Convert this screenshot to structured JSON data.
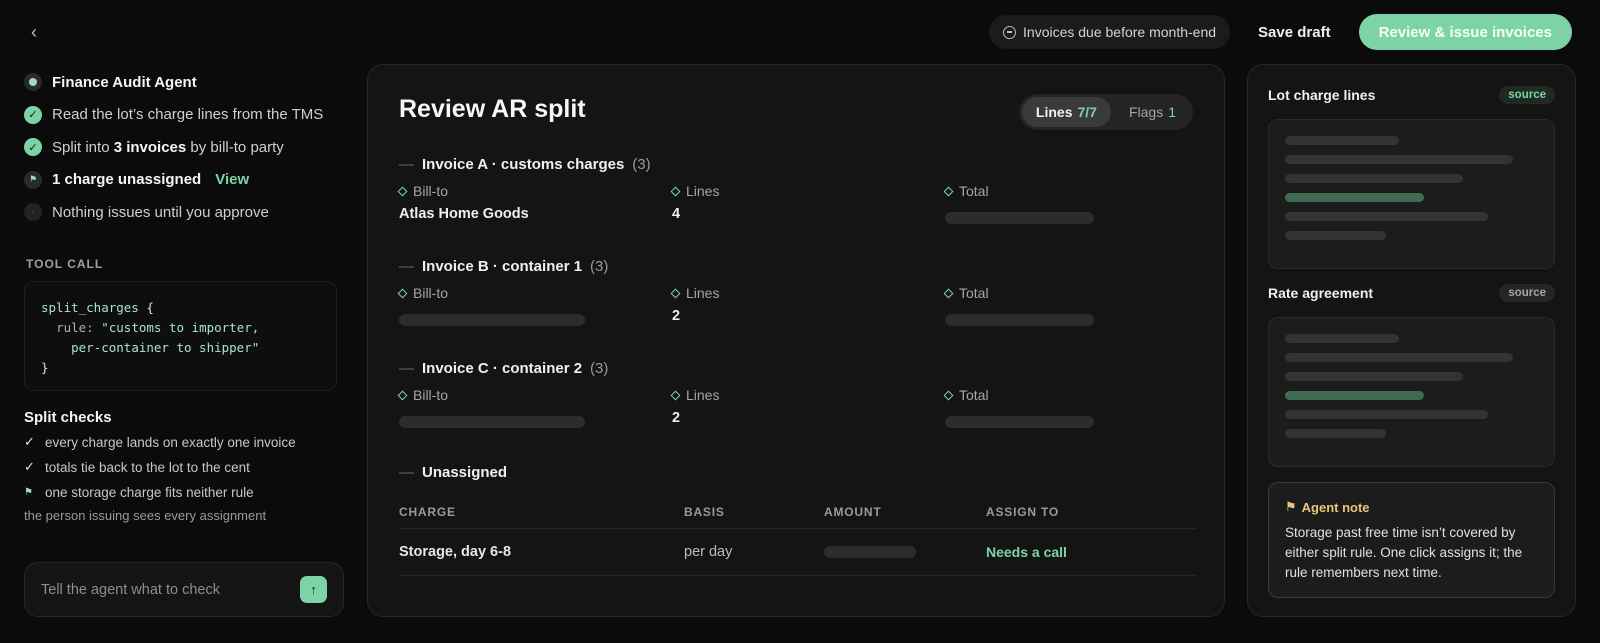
{
  "header": {
    "back_icon": "chevron-left-icon",
    "due_pill": "Invoices due before month-end",
    "save_draft": "Save draft",
    "primary_action": "Review & issue invoices"
  },
  "agent": {
    "title": "Finance Audit Agent",
    "steps": [
      {
        "status": "done",
        "text": "Read the lot’s charge lines from the TMS"
      },
      {
        "status": "done",
        "pre": "Split into ",
        "bold": "3 invoices",
        "post": " by bill-to party"
      },
      {
        "status": "flag",
        "bold": "1 charge unassigned",
        "link": "View"
      },
      {
        "status": "idle",
        "text": "Nothing issues until you approve"
      }
    ],
    "tool_call_label": "TOOL CALL",
    "tool_call": {
      "fn": "split_charges",
      "open": "{",
      "key": "rule:",
      "value_line1": "\"customs to importer,",
      "value_line2": "per-container to shipper\"",
      "close": "}"
    },
    "checks_title": "Split checks",
    "checks": [
      {
        "type": "check",
        "text": "every charge lands on exactly one invoice"
      },
      {
        "type": "check",
        "text": "totals tie back to the lot to the cent"
      },
      {
        "type": "flag",
        "text": "one storage charge fits neither rule"
      }
    ],
    "checks_note": "the person issuing sees every assignment",
    "input_placeholder": "Tell the agent what to check"
  },
  "review": {
    "title": "Review AR split",
    "tabs": [
      {
        "label": "Lines",
        "value": "7/7",
        "active": true
      },
      {
        "label": "Flags",
        "value": "1",
        "active": false
      }
    ],
    "field_labels": {
      "bill_to": "Bill-to",
      "lines": "Lines",
      "total": "Total"
    },
    "invoices": [
      {
        "name": "Invoice A · customs charges",
        "count": "(3)",
        "bill_to": "Atlas Home Goods",
        "lines": "4"
      },
      {
        "name": "Invoice B · container 1",
        "count": "(3)",
        "bill_to": "",
        "lines": "2"
      },
      {
        "name": "Invoice C · container 2",
        "count": "(3)",
        "bill_to": "",
        "lines": "2"
      }
    ],
    "unassigned": {
      "title": "Unassigned",
      "columns": [
        "CHARGE",
        "BASIS",
        "AMOUNT",
        "ASSIGN TO"
      ],
      "rows": [
        {
          "charge": "Storage, day 6-8",
          "basis": "per day",
          "assign": "Needs a call"
        }
      ]
    }
  },
  "sources": {
    "items": [
      {
        "title": "Lot charge lines",
        "badge": "source",
        "badge_color": "#7ed3a6"
      },
      {
        "title": "Rate agreement",
        "badge": "source",
        "badge_color": "#a5a5a5"
      }
    ],
    "note_title": "Agent note",
    "note_body": "Storage past free time isn’t covered by either split rule. One click assigns it; the rule remembers next time."
  },
  "colors": {
    "accent": "#7ed3a6",
    "background": "#0b0b0b",
    "panel": "#141414",
    "note_accent": "#e9c37a"
  }
}
